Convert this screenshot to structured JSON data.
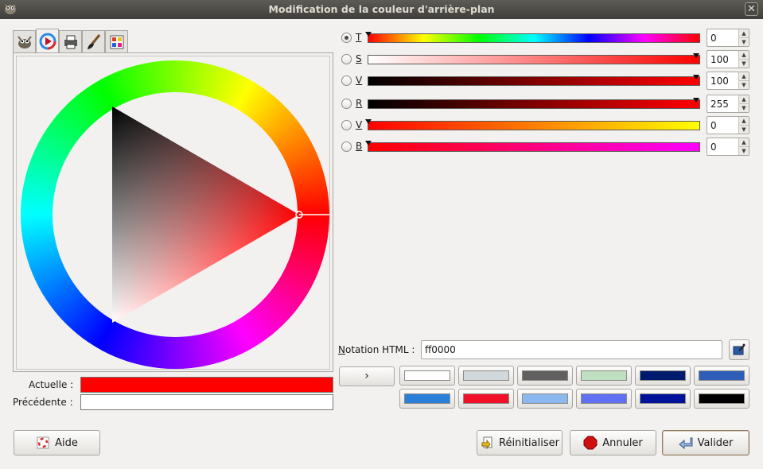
{
  "window": {
    "title": "Modification de la couleur d'arrière-plan",
    "close_glyph": "✕"
  },
  "tabs": [
    {
      "icon": "gimp-icon",
      "active": false
    },
    {
      "icon": "color-wheel-icon",
      "active": true
    },
    {
      "icon": "printer-cmyk-icon",
      "active": false
    },
    {
      "icon": "brush-icon",
      "active": false
    },
    {
      "icon": "palette-icon",
      "active": false
    }
  ],
  "sliders": [
    {
      "label": "T",
      "value": "0",
      "checked": true,
      "fraction": 0.0
    },
    {
      "label": "S",
      "value": "100",
      "checked": false,
      "fraction": 1.0
    },
    {
      "label": "V",
      "value": "100",
      "checked": false,
      "fraction": 1.0
    },
    {
      "label": "R",
      "value": "255",
      "checked": false,
      "fraction": 1.0
    },
    {
      "label": "V",
      "value": "0",
      "checked": false,
      "fraction": 0.0
    },
    {
      "label": "B",
      "value": "0",
      "checked": false,
      "fraction": 0.0
    }
  ],
  "current_label": "Actuelle :",
  "previous_label": "Précédente :",
  "current_color": "#ff0000",
  "previous_color": "#ffffff",
  "html_notation": {
    "label_prefix": "N",
    "label_rest": "otation HTML :",
    "value": "ff0000"
  },
  "history_button": "›",
  "history": [
    "#ffffff",
    "#d0d8dc",
    "#606060",
    "#bfe0c0",
    "#001a6e",
    "#2e5eb8",
    "#2a80d8",
    "#f0102a",
    "#8cb8f0",
    "#6070f0",
    "#00129a",
    "#000000"
  ],
  "buttons": {
    "help": "Aide",
    "reset": "Réinitialiser",
    "cancel": "Annuler",
    "ok": "Valider"
  }
}
